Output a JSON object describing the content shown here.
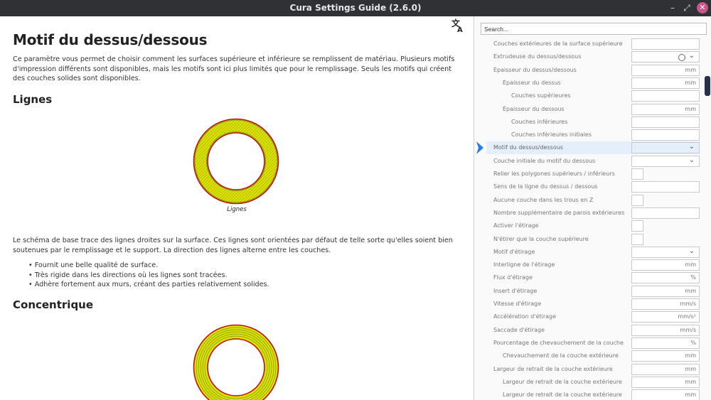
{
  "window": {
    "title": "Cura Settings Guide (2.6.0)",
    "minimize": "–",
    "maximize": "⤢",
    "close": "✕"
  },
  "doc": {
    "title": "Motif du dessus/dessous",
    "intro": "Ce paramètre vous permet de choisir comment les surfaces supérieure et inférieure se remplissent de matériau. Plusieurs motifs d'impression différents sont disponibles, mais les motifs sont ici plus limités que pour le remplissage. Seuls les motifs qui créent des couches solides sont disponibles.",
    "section1": {
      "heading": "Lignes",
      "caption": "Lignes",
      "body": "Le schéma de base trace des lignes droites sur la surface. Ces lignes sont orientées par défaut de telle sorte qu'elles soient bien soutenues par le remplissage et le support. La direction des lignes alterne entre les couches.",
      "bullets": [
        "Fournit une belle qualité de surface.",
        "Très rigide dans les directions où les lignes sont tracées.",
        "Adhère fortement aux murs, créant des parties relativement solides."
      ]
    },
    "section2": {
      "heading": "Concentrique"
    }
  },
  "panel": {
    "search_placeholder": "Search...",
    "settings": [
      {
        "label": "Couches extérieures de la surface supérieure",
        "indent": 1,
        "control": "field",
        "unit": ""
      },
      {
        "label": "Extrudeuse du dessus/dessous",
        "indent": 1,
        "control": "extruder",
        "unit": ""
      },
      {
        "label": "Épaisseur du dessus/dessous",
        "indent": 1,
        "control": "field",
        "unit": "mm"
      },
      {
        "label": "Épaisseur du dessus",
        "indent": 2,
        "control": "field",
        "unit": "mm"
      },
      {
        "label": "Couches supérieures",
        "indent": 3,
        "control": "field",
        "unit": ""
      },
      {
        "label": "Épaisseur du dessous",
        "indent": 2,
        "control": "field",
        "unit": "mm"
      },
      {
        "label": "Couches inférieures",
        "indent": 3,
        "control": "field",
        "unit": ""
      },
      {
        "label": "Couches inférieures initiales",
        "indent": 3,
        "control": "field",
        "unit": ""
      },
      {
        "label": "Motif du dessus/dessous",
        "indent": 1,
        "control": "combo",
        "unit": "",
        "active": true
      },
      {
        "label": "Couche initiale du motif du dessous",
        "indent": 1,
        "control": "combo",
        "unit": ""
      },
      {
        "label": "Relier les polygones supérieurs / inférieurs",
        "indent": 1,
        "control": "check",
        "unit": ""
      },
      {
        "label": "Sens de la ligne du dessus / dessous",
        "indent": 1,
        "control": "field",
        "unit": ""
      },
      {
        "label": "Aucune couche dans les trous en Z",
        "indent": 1,
        "control": "check",
        "unit": ""
      },
      {
        "label": "Nombre supplémentaire de parois extérieures",
        "indent": 1,
        "control": "field",
        "unit": ""
      },
      {
        "label": "Activer l'étirage",
        "indent": 1,
        "control": "check",
        "unit": ""
      },
      {
        "label": "N'étirer que la couche supérieure",
        "indent": 1,
        "control": "check",
        "unit": ""
      },
      {
        "label": "Motif d'étirage",
        "indent": 1,
        "control": "combo",
        "unit": ""
      },
      {
        "label": "Interligne de l'étirage",
        "indent": 1,
        "control": "field",
        "unit": "mm"
      },
      {
        "label": "Flux d'étirage",
        "indent": 1,
        "control": "field",
        "unit": "%"
      },
      {
        "label": "Insert d'étirage",
        "indent": 1,
        "control": "field",
        "unit": "mm"
      },
      {
        "label": "Vitesse d'étirage",
        "indent": 1,
        "control": "field",
        "unit": "mm/s"
      },
      {
        "label": "Accélération d'étirage",
        "indent": 1,
        "control": "field",
        "unit": "mm/s²"
      },
      {
        "label": "Saccade d'étirage",
        "indent": 1,
        "control": "field",
        "unit": "mm/s"
      },
      {
        "label": "Pourcentage de chevauchement de la couche extérieure",
        "indent": 1,
        "control": "field",
        "unit": "%"
      },
      {
        "label": "Chevauchement de la couche extérieure",
        "indent": 2,
        "control": "field",
        "unit": "mm"
      },
      {
        "label": "Largeur de retrait de la couche extérieure",
        "indent": 1,
        "control": "field",
        "unit": "mm"
      },
      {
        "label": "Largeur de retrait de la couche extérieure supérieure",
        "indent": 2,
        "control": "field",
        "unit": "mm"
      },
      {
        "label": "Largeur de retrait de la couche extérieure inférieure",
        "indent": 2,
        "control": "field",
        "unit": "mm"
      }
    ]
  },
  "icons": {
    "translate": "translate-icon",
    "pointer": "chevron-right-icon",
    "combo": "chevron-down-icon",
    "extruder": "extruder-circle-icon"
  },
  "colors": {
    "ring_fill": "#e0e000",
    "ring_lines": "#6a9a1c",
    "ring_wall": "#c01010",
    "pointer": "#2a7ae2",
    "titlebar": "#2f3134",
    "close": "#c8558b"
  }
}
